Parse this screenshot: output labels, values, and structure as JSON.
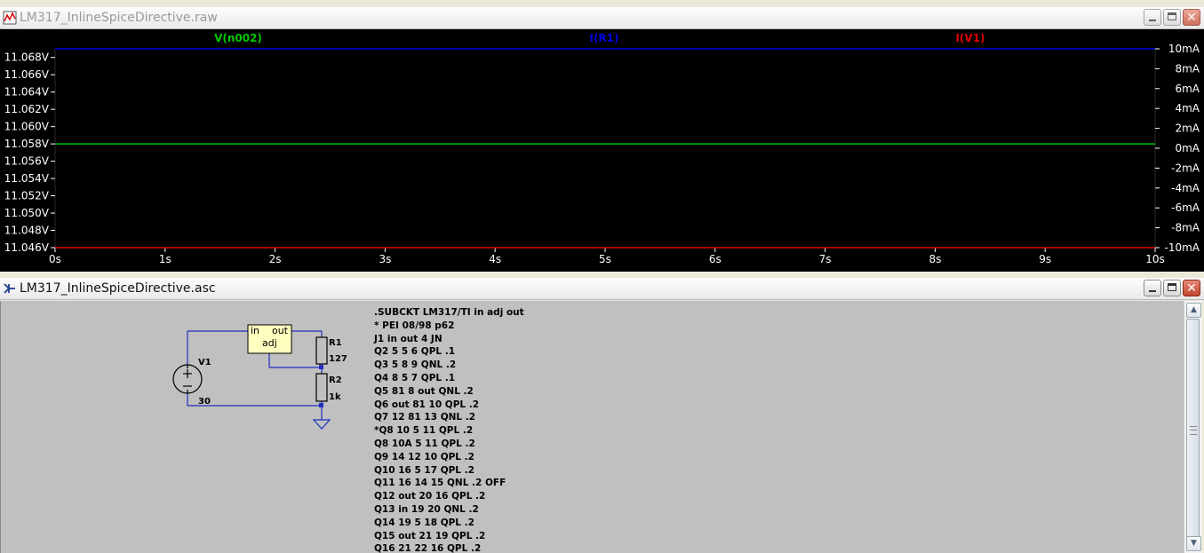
{
  "waveform_window": {
    "title": "LM317_InlineSpiceDirective.raw",
    "traces": [
      {
        "name": "V(n002)",
        "color": "#00c800"
      },
      {
        "name": "I(R1)",
        "color": "#0000e0"
      },
      {
        "name": "I(V1)",
        "color": "#e00000"
      }
    ],
    "left_axis_ticks": [
      "11.068V",
      "11.066V",
      "11.064V",
      "11.062V",
      "11.060V",
      "11.058V",
      "11.056V",
      "11.054V",
      "11.052V",
      "11.050V",
      "11.048V",
      "11.046V"
    ],
    "right_axis_ticks": [
      "10mA",
      "8mA",
      "6mA",
      "4mA",
      "2mA",
      "0mA",
      "-2mA",
      "-4mA",
      "-6mA",
      "-8mA",
      "-10mA"
    ],
    "x_axis_ticks": [
      "0s",
      "1s",
      "2s",
      "3s",
      "4s",
      "5s",
      "6s",
      "7s",
      "8s",
      "9s",
      "10s"
    ]
  },
  "chart_data": {
    "type": "line",
    "x": [
      0,
      10
    ],
    "xlim": [
      0,
      10
    ],
    "ylim_left": [
      11.046,
      11.069
    ],
    "ylim_right": [
      -10,
      10
    ],
    "series": [
      {
        "name": "V(n002)",
        "axis": "left",
        "unit": "V",
        "values": [
          11.058,
          11.058
        ]
      },
      {
        "name": "I(R1)",
        "axis": "right",
        "unit": "mA",
        "values": [
          10,
          10
        ]
      },
      {
        "name": "I(V1)",
        "axis": "right",
        "unit": "mA",
        "values": [
          -10,
          -10
        ]
      }
    ]
  },
  "schematic_window": {
    "title": "LM317_InlineSpiceDirective.asc",
    "components": {
      "block_pin_in": "in",
      "block_pin_out": "out",
      "block_pin_adj": "adj",
      "r1_name": "R1",
      "r1_value": "127",
      "r2_name": "R2",
      "r2_value": "1k",
      "v1_name": "V1",
      "v1_value": "30"
    },
    "netlist": [
      ".SUBCKT LM317/TI in adj out",
      "* PEI 08/98 p62",
      "J1 in out 4 JN",
      "Q2 5 5 6 QPL .1",
      "Q3 5 8 9 QNL .2",
      "Q4 8 5 7 QPL .1",
      "Q5 81 8 out QNL .2",
      "Q6 out 81 10 QPL .2",
      "Q7 12 81 13 QNL .2",
      "*Q8 10 5 11 QPL .2",
      "Q8 10A 5 11 QPL .2",
      "Q9 14 12 10 QPL .2",
      "Q10 16 5 17 QPL .2",
      "Q11 16 14 15 QNL .2 OFF",
      "Q12 out 20 16 QPL .2",
      "Q13 in 19 20 QNL .2",
      "Q14 19 5 18 QPL .2",
      "Q15 out 21 19 QPL .2",
      "Q16 21 22 16 QPL .2"
    ]
  }
}
